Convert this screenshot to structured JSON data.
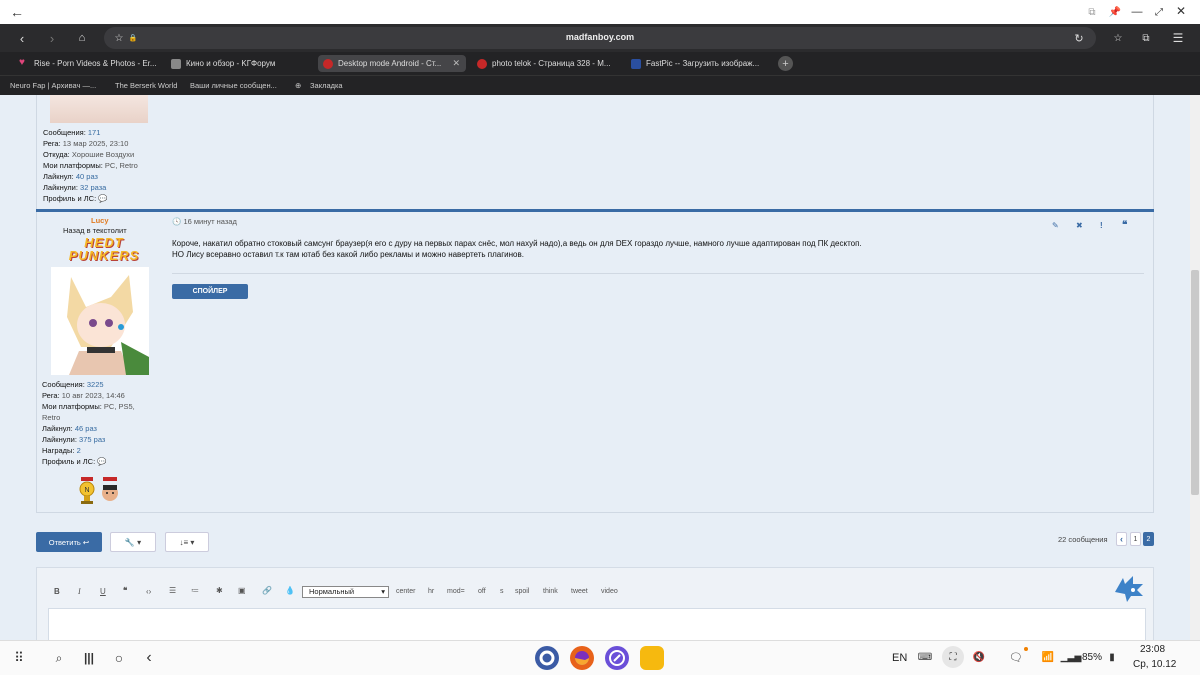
{
  "browser": {
    "url": "madfanboy.com",
    "tabs": [
      {
        "label": "Rise - Porn Videos & Photos - Er...",
        "color": "#e0457b"
      },
      {
        "label": "Кино и обзор - KГФорум",
        "color": "#888888"
      },
      {
        "label": "Desktop mode Android - Ст...",
        "color": "#c62828"
      },
      {
        "label": "photo telok - Страница 328 - M...",
        "color": "#c62828"
      },
      {
        "label": "FastPic -- Загрузить изображ...",
        "color": "#2a4fa0"
      }
    ],
    "bookmarks": [
      "Neuro Fap | Архивач —...",
      "The Berserk World",
      "Ваши личные сообщен...",
      "Закладка"
    ]
  },
  "prev_post": {
    "stats": [
      {
        "k": "Сообщения:",
        "v": "171"
      },
      {
        "k": "Рега:",
        "v": "13 мар 2025, 23:10"
      },
      {
        "k": "Откуда:",
        "v": "Хорошие Воздухи"
      },
      {
        "k": "Мои платформы:",
        "v": "PC, Retro"
      },
      {
        "k": "Лайкнул:",
        "v": "40 раз"
      },
      {
        "k": "Лайкнули:",
        "v": "32 раза"
      },
      {
        "k": "Профиль и ЛС:",
        "v": ""
      }
    ]
  },
  "post": {
    "author": "Lucy",
    "rank": "Назад в текстолит",
    "banner": "HEDT PUNKERS",
    "time": "16 минут назад",
    "text1": "Короче, накатил обратно стоковый самсунг браузер(я его с дуру на первых парах снёс, мол нахуй надо),а ведь он для DEX гораздо лучше, намного лучше адаптирован под ПК десктоп.",
    "text2": "НО Лису всеравно оставил т.к там ютаб без какой либо рекламы и можно навертеть плагинов.",
    "spoiler": "СПОЙЛЕР",
    "stats": [
      {
        "k": "Сообщения:",
        "v": "3225"
      },
      {
        "k": "Рега:",
        "v": "10 авг 2023, 14:46"
      },
      {
        "k": "Мои платформы:",
        "v": "PC, PS5,"
      },
      {
        "k": "",
        "v": "Retro"
      },
      {
        "k": "Лайкнул:",
        "v": "46 раз"
      },
      {
        "k": "Лайкнули:",
        "v": "375 раз"
      },
      {
        "k": "Награды:",
        "v": "2"
      },
      {
        "k": "Профиль и ЛС:",
        "v": ""
      }
    ]
  },
  "controls": {
    "reply": "Ответить",
    "count": "22 сообщения",
    "pages": [
      "1",
      "2"
    ]
  },
  "editor": {
    "select": "Нормальный",
    "tags": [
      "center",
      "hr",
      "mod=",
      "off",
      "s",
      "spoil",
      "think",
      "tweet",
      "video"
    ]
  },
  "taskbar": {
    "lang": "EN",
    "battery": "85%",
    "time": "23:08",
    "date": "Ср, 10.12"
  }
}
